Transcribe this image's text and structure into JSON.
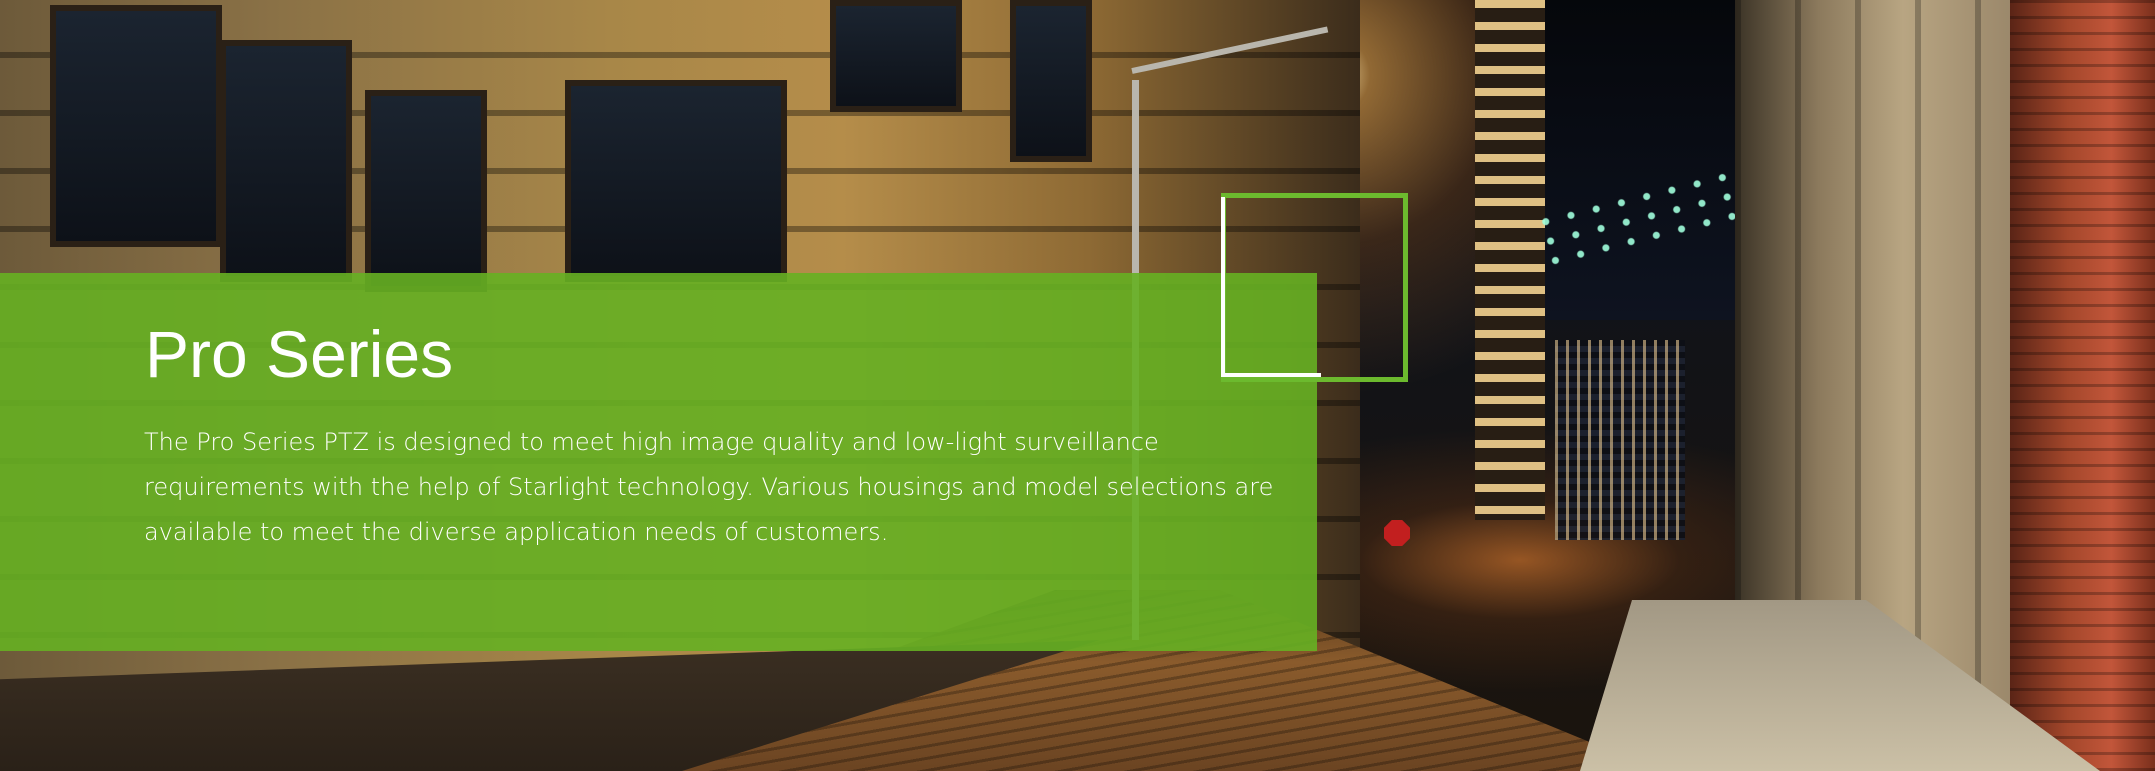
{
  "banner": {
    "title": "Pro Series",
    "description": "The Pro Series PTZ is designed to meet high image quality and low-light surveillance requirements with the help of Starlight technology. Various housings and model selections are available to meet the diverse application needs of customers."
  },
  "colors": {
    "panel_green": "#66b022",
    "frame_green": "#6cba2e",
    "text": "#ffffff"
  },
  "background": {
    "scene": "night-city-street-photo"
  }
}
